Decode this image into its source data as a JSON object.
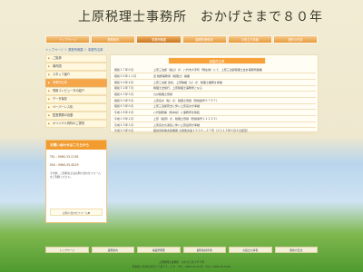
{
  "title": "上原税理士事務所　おかげさまで８０年",
  "nav": [
    {
      "label": "トップページ",
      "active": false
    },
    {
      "label": "業務案内",
      "active": false
    },
    {
      "label": "事業所概要",
      "active": true
    },
    {
      "label": "顧問先様専用",
      "active": false
    },
    {
      "label": "お役立ち情報",
      "active": false
    },
    {
      "label": "税的の日誌",
      "active": false
    }
  ],
  "breadcrumb": "トップページ ＞ 業務所概要 ＞ 事業所沿革",
  "sidebar": {
    "items": [
      {
        "label": "ご挨拶",
        "active": false
      },
      {
        "label": "案内図",
        "active": false
      },
      {
        "label": "スタッフ紹介",
        "active": false
      },
      {
        "label": "事業所沿革",
        "active": true
      },
      {
        "label": "専用コンピュータの紹介",
        "active": false
      },
      {
        "label": "データ保存",
        "active": false
      },
      {
        "label": "ペーパーレス化",
        "active": false
      },
      {
        "label": "監査業務の自動",
        "active": false
      },
      {
        "label": "オリジナル資料のご提供",
        "active": false
      }
    ]
  },
  "contact": {
    "header": "お問い合わせはこちらから",
    "tel": "TEL : 0965-33-2136",
    "fax": "FAX : 0965-35-8219",
    "desc": "その他、ご質問などはお問い合わせフォームをご利用ください。",
    "button": "お問い合わせフォーム▼"
  },
  "main": {
    "heading": "事務所沿革",
    "rows": [
      {
        "date": "昭和１７年６月",
        "text": "上原三治郎（祖父）が、八代市大手町（現在地）にて、上原三治郎税理士会計事務所開業"
      },
      {
        "date": "昭和２５年１１月",
        "text": "旧 税務事務者（税理士）開業"
      },
      {
        "date": "昭和２６年４月",
        "text": "上原三治郎 改め、上原敏雄（父）が、税理士業務を承継"
      },
      {
        "date": "昭和３２年７月",
        "text": "税理士法施行、上原税理士事務所となる"
      },
      {
        "date": "昭和４３年２月",
        "text": "九州税理士登録"
      },
      {
        "date": "昭和６０年５月",
        "text": "上原良文（私）が、税理士登録（登録番号６７９７）"
      },
      {
        "date": "昭和６３年６月",
        "text": "上原三治郎死去に伴い上原良文が承継"
      },
      {
        "date": "平成１８年４月",
        "text": "八代税務署（熊本県）に事務所を移転"
      },
      {
        "date": "平成１９年１月",
        "text": "上原（長男）が、税理士登録（登録番号１１２２５）"
      },
      {
        "date": "平成２３年１月",
        "text": "上原良文の退任に伴い上原益男が承継"
      },
      {
        "date": "平成２５年６月",
        "text": "経営革新等支援機関 九財後支第１５２６－２７号（２０１３年６月４日認定）"
      }
    ]
  },
  "footer": {
    "nav": [
      "トップページ",
      "業務案内",
      "事業所概要",
      "顧問先様専用",
      "お役立ち情報",
      "税的の日誌"
    ],
    "line1": "上原税理士事務所　おかげさまで８０年",
    "line2": "熊本県八代市大手町１丁目３２－１６　TEL：0965-33-2136　FAX：0965-35-8219"
  }
}
